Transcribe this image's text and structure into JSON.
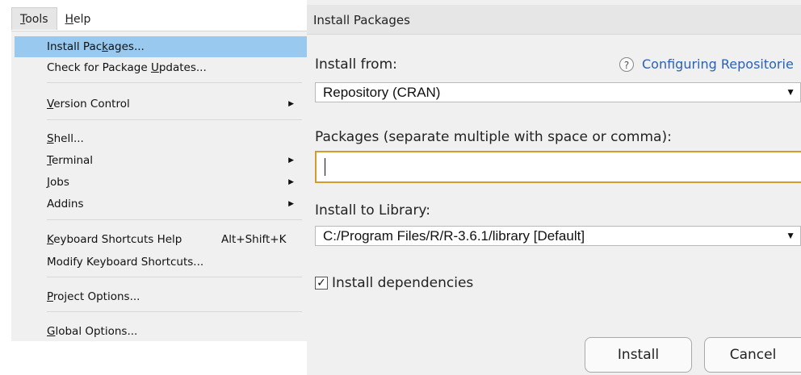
{
  "menubar": {
    "tools": {
      "accel": "T",
      "rest": "ools"
    },
    "help": {
      "accel": "H",
      "rest": "elp"
    }
  },
  "menu": {
    "install_packages": {
      "pre": "Install Pac",
      "acc": "k",
      "post": "ages..."
    },
    "check_updates": {
      "pre": "Check for Package ",
      "acc": "U",
      "post": "pdates..."
    },
    "version_control": {
      "pre": "",
      "acc": "V",
      "post": "ersion Control"
    },
    "shell": {
      "pre": "",
      "acc": "S",
      "post": "hell..."
    },
    "terminal": {
      "pre": "",
      "acc": "T",
      "post": "erminal"
    },
    "jobs": {
      "pre": "",
      "acc": "J",
      "post": "obs"
    },
    "addins": {
      "label": "Addins"
    },
    "keyboard_help": {
      "pre": "",
      "acc": "K",
      "post": "eyboard Shortcuts Help",
      "shortcut": "Alt+Shift+K"
    },
    "modify_shortcuts": {
      "label": "Modify Keyboard Shortcuts..."
    },
    "project_options": {
      "pre": "",
      "acc": "P",
      "post": "roject Options..."
    },
    "global_options": {
      "pre": "",
      "acc": "G",
      "post": "lobal Options..."
    }
  },
  "dialog": {
    "title": "Install Packages",
    "install_from_label": "Install from:",
    "help_icon": "?",
    "help_link": "Configuring Repositorie",
    "install_from_value": "Repository (CRAN)",
    "packages_label": "Packages (separate multiple with space or comma):",
    "packages_value": "",
    "library_label": "Install to Library:",
    "library_value": "C:/Program Files/R/R-3.6.1/library [Default]",
    "dropdown_glyph": "▼",
    "dependencies_label": "Install dependencies",
    "dependencies_checked": true,
    "check_glyph": "✓",
    "install_button": "Install",
    "cancel_button": "Cancel"
  }
}
